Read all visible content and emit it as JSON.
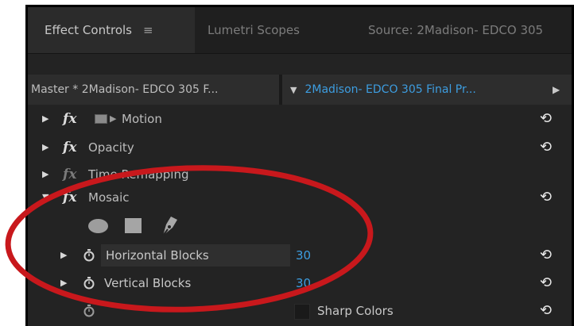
{
  "tabs": [
    {
      "label": "Effect Controls",
      "menu_glyph": "≡",
      "active": true
    },
    {
      "label": "Lumetri Scopes",
      "active": false
    },
    {
      "label": "Source: 2Madison- EDCO 305",
      "active": false
    }
  ],
  "clip_row": {
    "master_label": "Master * 2Madison- EDCO 305 F...",
    "dropdown_glyph": "▼",
    "clip_label": "2Madison- EDCO 305 Final Pr...",
    "arrow_glyph": "▶"
  },
  "effects": [
    {
      "name": "Motion",
      "icon": "motion-icon",
      "twirl": "▶",
      "fx": "fx",
      "reset": "reset-icon"
    },
    {
      "name": "Opacity",
      "twirl": "▶",
      "fx": "fx",
      "reset": "reset-icon"
    },
    {
      "name": "Time Remapping",
      "twirl": "▶",
      "fx": "fx"
    },
    {
      "name": "Mosaic",
      "twirl": "▼",
      "fx": "fx",
      "reset": "reset-icon"
    }
  ],
  "mask_tools": [
    "ellipse-mask-icon",
    "rectangle-mask-icon",
    "pen-mask-icon"
  ],
  "params": [
    {
      "name": "Horizontal Blocks",
      "value": "30",
      "twirl": "▶"
    },
    {
      "name": "Vertical Blocks",
      "value": "30",
      "twirl": "▶"
    },
    {
      "name": "Sharp Colors",
      "checked": false
    }
  ],
  "glyphs": {
    "reset": "⟲"
  },
  "colors": {
    "accent_blue": "#3d9de0",
    "annotation_red": "#c8181c",
    "panel_bg": "#232323"
  }
}
